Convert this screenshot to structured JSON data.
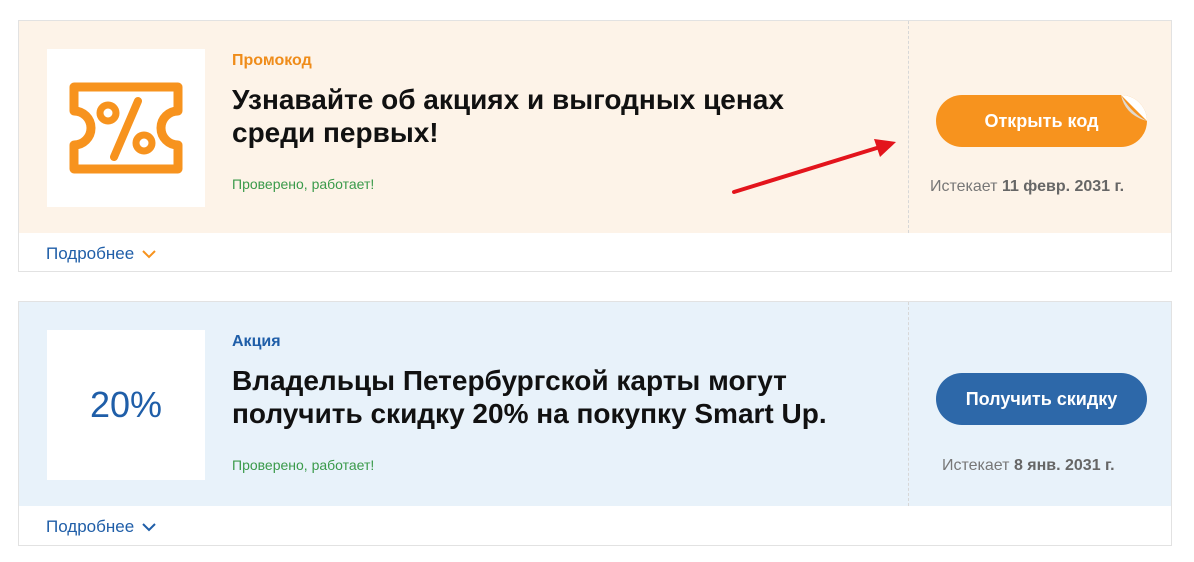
{
  "offers": [
    {
      "type_label": "Промокод",
      "title": "Узнавайте об акциях и выгодных ценах среди первых!",
      "verified": "Проверено, работает!",
      "button_label": "Открыть код",
      "expires_prefix": "Истекает ",
      "expires_date": "11 февр. 2031 г.",
      "more_label": "Подробнее",
      "logo_icon": "coupon-percent-icon",
      "accent": "#f7931e",
      "bg": "#fdf3e8"
    },
    {
      "type_label": "Акция",
      "title": "Владельцы Петербургской карты могут получить скидку 20% на покупку Smart Up.",
      "verified": "Проверено, работает!",
      "logo_text": "20%",
      "button_label": "Получить скидку",
      "expires_prefix": "Истекает ",
      "expires_date": "8 янв. 2031 г.",
      "more_label": "Подробнее",
      "accent": "#2d68a9",
      "bg": "#e8f2fa"
    }
  ],
  "annotation": {
    "icon": "red-arrow-icon",
    "color": "#e3141c"
  }
}
